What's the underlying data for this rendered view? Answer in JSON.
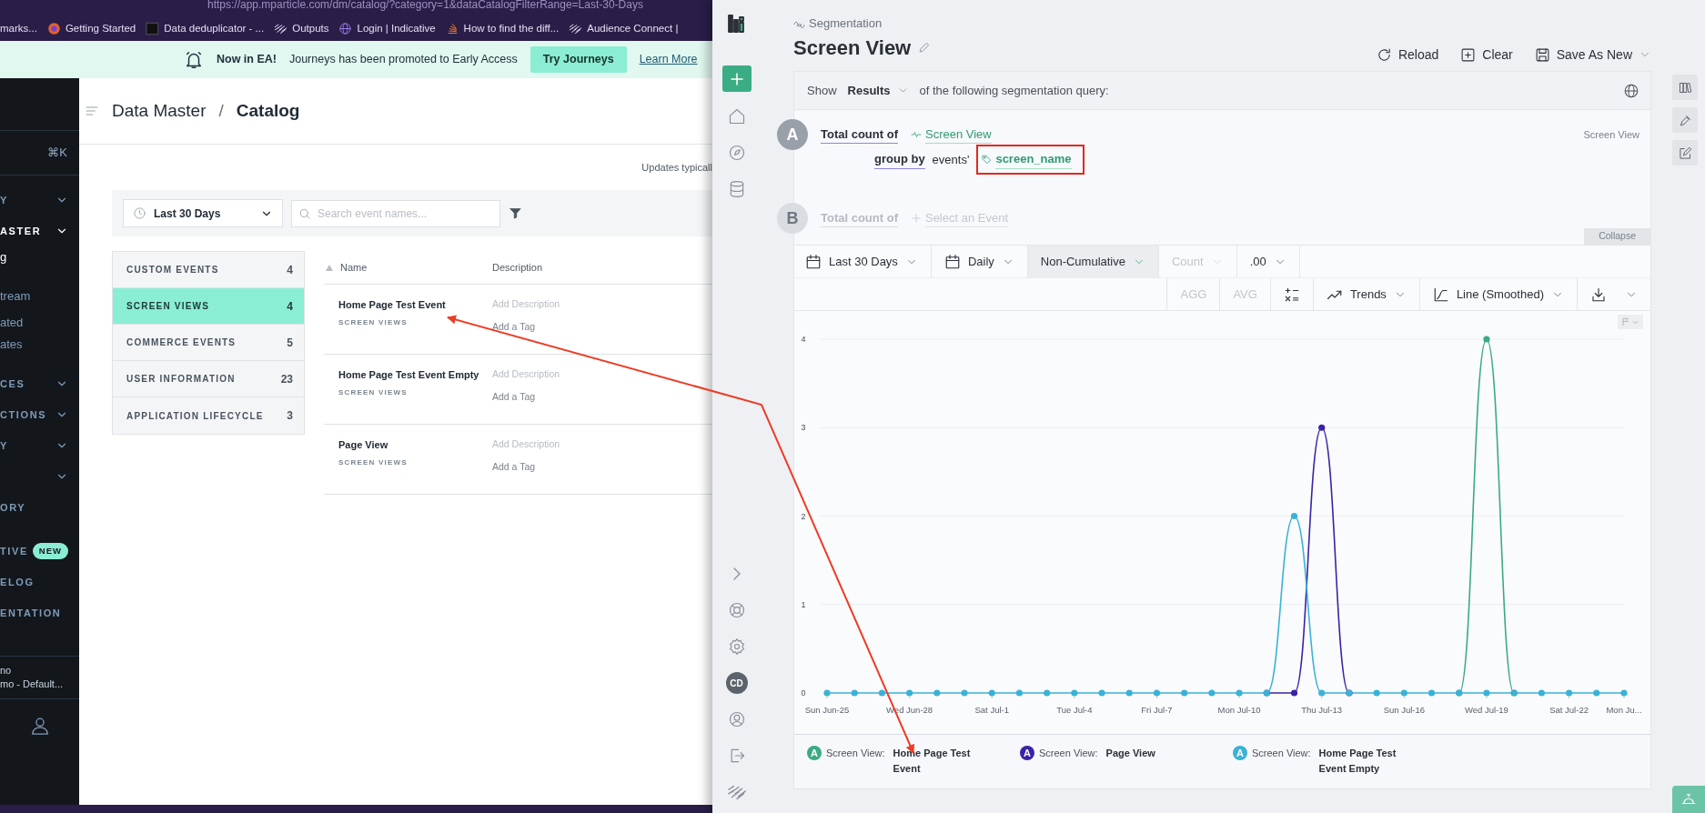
{
  "browser": {
    "url": "https://app.mparticle.com/dm/catalog/?category=1&dataCatalogFilterRange=Last-30-Days",
    "bookmarks": [
      {
        "label": "marks..."
      },
      {
        "kind": "round",
        "label": "Getting Started"
      },
      {
        "kind": "square",
        "label": "Data deduplicator - ..."
      },
      {
        "kind": "stripes",
        "label": "Outputs"
      },
      {
        "kind": "globe",
        "label": "Login | Indicative"
      },
      {
        "kind": "stack",
        "label": "How to find the diff..."
      },
      {
        "kind": "stripes",
        "label": "Audience Connect |"
      }
    ]
  },
  "banner": {
    "title": "Now in EA!",
    "message": "Journeys has been promoted to Early Access",
    "button": "Try Journeys",
    "link": "Learn More"
  },
  "left_nav": {
    "shortcut": "⌘K",
    "groups": [
      [
        {
          "kind": "section",
          "label": "Y",
          "active": false
        },
        {
          "kind": "section",
          "label": "ASTER",
          "active": true
        },
        {
          "kind": "link",
          "label": "g",
          "active": true
        }
      ],
      [
        {
          "kind": "link",
          "label": "tream",
          "active": false
        },
        {
          "kind": "link",
          "label": "ated",
          "active": false
        },
        {
          "kind": "link",
          "label": "ates",
          "active": false
        }
      ],
      [
        {
          "kind": "section",
          "label": "CES",
          "active": false
        },
        {
          "kind": "section",
          "label": "CTIONS",
          "active": false
        },
        {
          "kind": "section",
          "label": "Y",
          "active": false
        },
        {
          "kind": "section",
          "active": false
        },
        {
          "kind": "plain",
          "label": "ORY",
          "active": false
        }
      ],
      [
        {
          "kind": "plain",
          "label": "TIVE",
          "badge": "NEW",
          "active": false
        },
        {
          "kind": "plain",
          "label": "ELOG",
          "active": false
        },
        {
          "kind": "plain",
          "label": "ENTATION",
          "active": false
        }
      ]
    ],
    "account": [
      "no",
      "mo - Default..."
    ]
  },
  "catalog": {
    "breadcrumb": [
      "Data Master",
      "/",
      "Catalog"
    ],
    "updates_note": "Updates typicall",
    "date_filter": "Last 30 Days",
    "search": {
      "placeholder": "Search event names..."
    },
    "categories": [
      {
        "label": "CUSTOM EVENTS",
        "count": "4",
        "selected": false
      },
      {
        "label": "SCREEN VIEWS",
        "count": "4",
        "selected": true
      },
      {
        "label": "COMMERCE EVENTS",
        "count": "5",
        "selected": false
      },
      {
        "label": "USER INFORMATION",
        "count": "23",
        "selected": false
      },
      {
        "label": "APPLICATION LIFECYCLE",
        "count": "3",
        "selected": false
      }
    ],
    "columns": [
      "Name",
      "Description"
    ],
    "rows": [
      {
        "name": "Home Page Test Event",
        "category": "SCREEN VIEWS",
        "description": "Add Description",
        "tag": "Add a Tag"
      },
      {
        "name": "Home Page Test Event Empty",
        "category": "SCREEN VIEWS",
        "description": "Add Description",
        "tag": "Add a Tag"
      },
      {
        "name": "Page View",
        "category": "SCREEN VIEWS",
        "description": "Add Description",
        "tag": "Add a Tag"
      }
    ]
  },
  "app": {
    "breadcrumb": "Segmentation",
    "title": "Screen View",
    "avatar": "CD",
    "actions": [
      {
        "kind": "reload",
        "label": "Reload",
        "dropdown": false
      },
      {
        "kind": "clear",
        "label": "Clear",
        "dropdown": false
      },
      {
        "kind": "save",
        "label": "Save As New",
        "dropdown": true
      }
    ],
    "query": {
      "show_label": "Show",
      "mode": "Results",
      "suffix": "of the following segmentation query:",
      "rows": [
        {
          "letter": "A",
          "active": true,
          "prefix": "Total count of",
          "event": "Screen View",
          "group_by": "group by",
          "group_prefix": "events'",
          "property": "screen_name",
          "side_label": "Screen View"
        },
        {
          "letter": "B",
          "active": false,
          "prefix": "Total count of",
          "event_placeholder": "Select an Event"
        }
      ],
      "collapse": "Collapse"
    },
    "toolbar": {
      "row_1": [
        {
          "kind": "date",
          "label": "Last 30 Days",
          "highlighted": false,
          "disabled": false
        },
        {
          "kind": "interval",
          "label": "Daily",
          "highlighted": false,
          "disabled": false
        },
        {
          "kind": "mode",
          "label": "Non-Cumulative",
          "highlighted": true,
          "disabled": false
        },
        {
          "kind": "measure",
          "label": "Count",
          "highlighted": false,
          "disabled": true
        },
        {
          "kind": "format",
          "label": ".00",
          "highlighted": false,
          "disabled": false
        }
      ],
      "row_2": [
        {
          "kind": "text",
          "label": "AGG",
          "disabled": true
        },
        {
          "kind": "text",
          "label": "AVG",
          "disabled": true
        },
        {
          "kind": "formula",
          "disabled": false
        },
        {
          "kind": "trends",
          "label": "Trends",
          "disabled": false
        },
        {
          "kind": "chart_type",
          "label": "Line (Smoothed)",
          "disabled": false
        },
        {
          "kind": "download",
          "disabled": false
        }
      ]
    },
    "chart_data": {
      "type": "line",
      "categories": [
        "Sun Jun-25",
        null,
        null,
        "Wed Jun-28",
        null,
        null,
        "Sat Jul-1",
        null,
        null,
        "Tue Jul-4",
        null,
        null,
        "Fri Jul-7",
        null,
        null,
        "Mon Jul-10",
        null,
        null,
        "Thu Jul-13",
        null,
        null,
        "Sun Jul-16",
        null,
        null,
        "Wed Jul-19",
        null,
        null,
        "Sat Jul-22",
        null,
        "Mon Ju..."
      ],
      "ylim": [
        0,
        4
      ],
      "yticks": [
        0,
        1,
        2,
        3,
        4
      ],
      "grid": true,
      "series": [
        {
          "name": "Home Page Test Event",
          "color": "#3aaa83",
          "marker": true,
          "values": [
            null,
            null,
            null,
            null,
            null,
            null,
            null,
            null,
            null,
            null,
            null,
            null,
            null,
            null,
            null,
            null,
            null,
            null,
            null,
            null,
            null,
            null,
            null,
            0,
            4,
            0,
            null,
            null,
            null,
            null
          ]
        },
        {
          "name": "Page View",
          "color": "#3b23a6",
          "marker": true,
          "values": [
            null,
            null,
            null,
            null,
            null,
            null,
            null,
            null,
            null,
            null,
            null,
            null,
            null,
            null,
            null,
            null,
            0,
            0,
            3,
            0,
            null,
            null,
            null,
            null,
            null,
            null,
            null,
            null,
            null,
            null
          ]
        },
        {
          "name": "Home Page Test Event Empty",
          "color": "#3ab2d6",
          "marker": true,
          "values": [
            0,
            0,
            0,
            0,
            0,
            0,
            0,
            0,
            0,
            0,
            0,
            0,
            0,
            0,
            0,
            0,
            0,
            2,
            0,
            0,
            0,
            0,
            0,
            0,
            0,
            0,
            0,
            0,
            0,
            0
          ]
        }
      ]
    },
    "legend": [
      {
        "letter": "A",
        "prefix": "Screen View:"
      },
      {
        "letter": "A",
        "prefix": "Screen View:"
      },
      {
        "letter": "A",
        "prefix": "Screen View:"
      }
    ]
  }
}
